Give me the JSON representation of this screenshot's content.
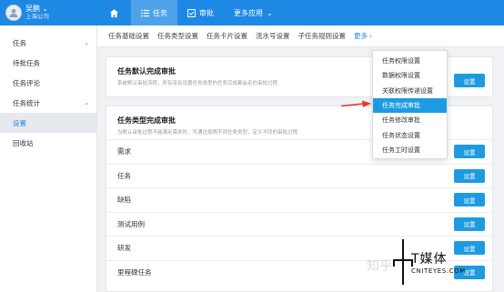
{
  "user": {
    "name": "吴鹏",
    "company": "上海公司"
  },
  "nav": {
    "tasks": "任务",
    "approval": "审批",
    "more_apps": "更多应用"
  },
  "sidebar": {
    "items": [
      {
        "label": "任务"
      },
      {
        "label": "待批任务"
      },
      {
        "label": "任务评论"
      },
      {
        "label": "任务统计"
      },
      {
        "label": "设置"
      },
      {
        "label": "回收站"
      }
    ]
  },
  "tabs": [
    "任务基础设置",
    "任务类型设置",
    "任务卡片设置",
    "流水号设置",
    "子任务规则设置",
    "更多"
  ],
  "card1": {
    "title": "任务默认完成审批",
    "desc": "系统默认审批流程，所有没有设置任务类型的任务完成都会走的审批过程",
    "button": "设置"
  },
  "card2": {
    "title": "任务类型完成审批",
    "desc": "当默认审批过程不能满足需求时，可通过按照不同任务类型，定义不同的审批过程",
    "rows": [
      "需求",
      "任务",
      "缺陷",
      "测试用例",
      "研发",
      "里程碑任务"
    ],
    "button": "设置"
  },
  "dropdown": {
    "items": [
      "任务权限设置",
      "数据权限设置",
      "关联权限传递设置",
      "任务完成审批",
      "任务修改审批",
      "任务状态设置",
      "任务工时设置"
    ],
    "active_index": 3
  },
  "watermark": {
    "left": "知乎",
    "brand": "T媒体",
    "url": "CNITEYES.COM"
  },
  "colors": {
    "primary": "#1e88e5",
    "button": "#1e9be0",
    "arrow": "#e53935"
  }
}
